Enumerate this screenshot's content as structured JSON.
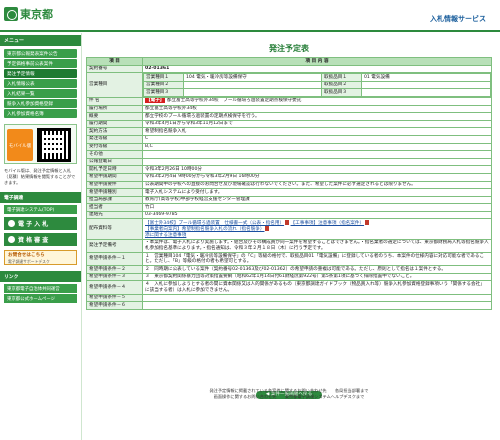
{
  "header": {
    "logo_text": "東京都",
    "service_title": "入札情報サービス"
  },
  "sidebar": {
    "menu_title": "メニュー",
    "items": [
      {
        "label": "東京都公報発表案件公告"
      },
      {
        "label": "予定価格事前公表案件"
      },
      {
        "label": "発注予定情報"
      },
      {
        "label": "入札情報公表"
      },
      {
        "label": "入札結果一覧"
      },
      {
        "label": "競争入札参加資格登録"
      },
      {
        "label": "入札参加資格名簿"
      }
    ],
    "mobile_label": "モバイル版",
    "mobile_note": "モバイル版は、発注予定情報と入札（見積）結果情報を閲覧することができます。",
    "e_procure_title": "電子調達",
    "e_procure_link": "電子調達システム(TOP)",
    "e_bid_label": "電 子 入 札",
    "qualif_label": "資 格 審 査",
    "contact_label": "お問合せはこちら",
    "contact_sub": "電子調達サポートデスク",
    "links_title": "リンク",
    "links": [
      {
        "label": "東京都電子自治体共同運営"
      },
      {
        "label": "東京都公式ホームページ"
      }
    ]
  },
  "page_title": "発注予定表",
  "table": {
    "head_item": "項 目",
    "head_content": "項 目 内 容",
    "contract_no_label": "契約番号",
    "contract_no": "02-01361",
    "business_type_label": "営業種目",
    "business_rows": [
      {
        "k1": "営業種目１",
        "v1": "104 電気・暖冷房等設備保守",
        "k2": "取扱品目１",
        "v2": "01 電気設備"
      },
      {
        "k1": "営業種目２",
        "v1": "",
        "k2": "取扱品目２",
        "v2": ""
      },
      {
        "k1": "営業種目３",
        "v1": "",
        "k2": "取扱品目３",
        "v2": ""
      }
    ],
    "name_label": "件 名",
    "name_tag": "【電子】",
    "name_text": "都立富士高等学校外34校　プール循環ろ過装置定期点検保守委託",
    "place_label": "履行場所",
    "place": "都立富士高等学校外34校",
    "summary_label": "概要",
    "summary": "都立学校のプール循環ろ過装置の定期点検保守を行う。",
    "period_label": "履行期間",
    "period": "令和3年4月1日から令和3年11月12日まで",
    "method_label": "契約方法",
    "method": "希望制指名競争入札",
    "grade_label": "発注等級",
    "grade": "C",
    "accept_label": "受付等級",
    "accept": "B,C",
    "other_label": "その他",
    "pub_date_label": "公報登載日",
    "pub_date": "",
    "open_date_label": "開札予定日時",
    "open_date": "令和3年2月26日 10時00分",
    "apply_period_label": "希望申請期間",
    "apply_period": "令和3年2月4日 9時00分から令和3年2月9日 16時00分",
    "apply_req_label": "希望申請要件",
    "apply_req": "公表期間中の学校への直接のお問合せ及び現場確認は行わないでください。また、希望した案件に必ず選定されるとは限りません。",
    "apply_type_label": "希望申請種別",
    "apply_type": "電子入札システムにより受付します。",
    "dept_label": "担当局部課",
    "dept": "教育庁(高等学校)中部学校経営支援センター管理課",
    "person_label": "担当者",
    "person": "竹口",
    "tel_label": "連絡先",
    "tel": "03-3469-9785",
    "docs_label": "配布資料等",
    "docs": [
      "【富士外34校】プール循環ろ過装置　仕様書一式（公表・指名用）",
      "【工事事項】注意事項（指名案件）",
      "【事業者向案内】希望制指名競争入札の流れ（指名競争）"
    ],
    "docs_extra": "添に関する注意事項",
    "notice_label": "発注予定備考",
    "notice": "・本案件は、電子入札により実施します。・組合及びその構成員が同一案件を希望することはできません。・指名業者の選定については、東京都財務局入札等指名競争入札参加指名基準によります。・指名通知は、令和３年２月１８日（木）に行う予定です。",
    "cond_rows": [
      {
        "k": "希望申請条件－１",
        "v": "１　営業種目104「電気・暖冷房等設備保守」の「C」等級の格付で、取扱品目01「電気設備」に登録している者のうち、本案件の仕様内容に対応可能な者であること。ただし、「B」等級の格付の者も希望可とする。"
      },
      {
        "k": "希望申請条件－２",
        "v": "２　同時期に公表している案件（契約番号02-01363及び02-01362）の希望申請の重複は可能である。ただし、原則として指名は１案件とする。"
      },
      {
        "k": "希望申請条件－３",
        "v": "３　東京都契約関係暴力団等対策措置要綱（昭和62年1月14日付61財経庶第922号）第5条第1項に基づく排除措置中でないこと。"
      },
      {
        "k": "希望申請条件－４",
        "v": "４　入札に参加しようとする者の間に資本関係又は人的関係があるもの（東京都調達ガイドブック（物品買入れ等）競争入札参加資格登録事項いう「関係する会社」に該当する者）は入札に参加できません。"
      },
      {
        "k": "希望申請条件－５",
        "v": ""
      },
      {
        "k": "希望申請条件－６",
        "v": ""
      }
    ]
  },
  "back_button": "案件一覧画面へ戻る",
  "footer": {
    "line1": "発注予定情報に掲載されている各案件に関するお問い合わせ先　　各局担当部署まで",
    "line2": "画面操作に関するお問い合わせ先　　東京都電子調達システムヘルプデスクまで"
  }
}
